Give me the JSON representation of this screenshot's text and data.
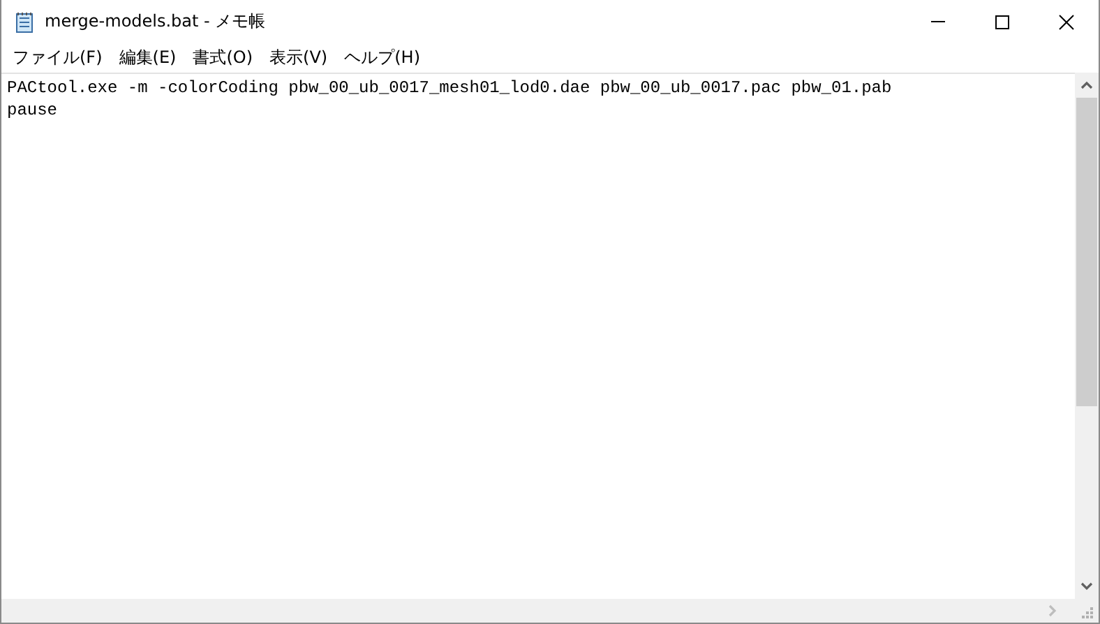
{
  "window": {
    "title": "merge-models.bat - メモ帳"
  },
  "menu": [
    "ファイル(F)",
    "編集(E)",
    "書式(O)",
    "表示(V)",
    "ヘルプ(H)"
  ],
  "editor": {
    "lines": [
      "PACtool.exe -m -colorCoding pbw_00_ub_0017_mesh01_lod0.dae pbw_00_ub_0017.pac pbw_01.pab",
      "pause"
    ]
  }
}
